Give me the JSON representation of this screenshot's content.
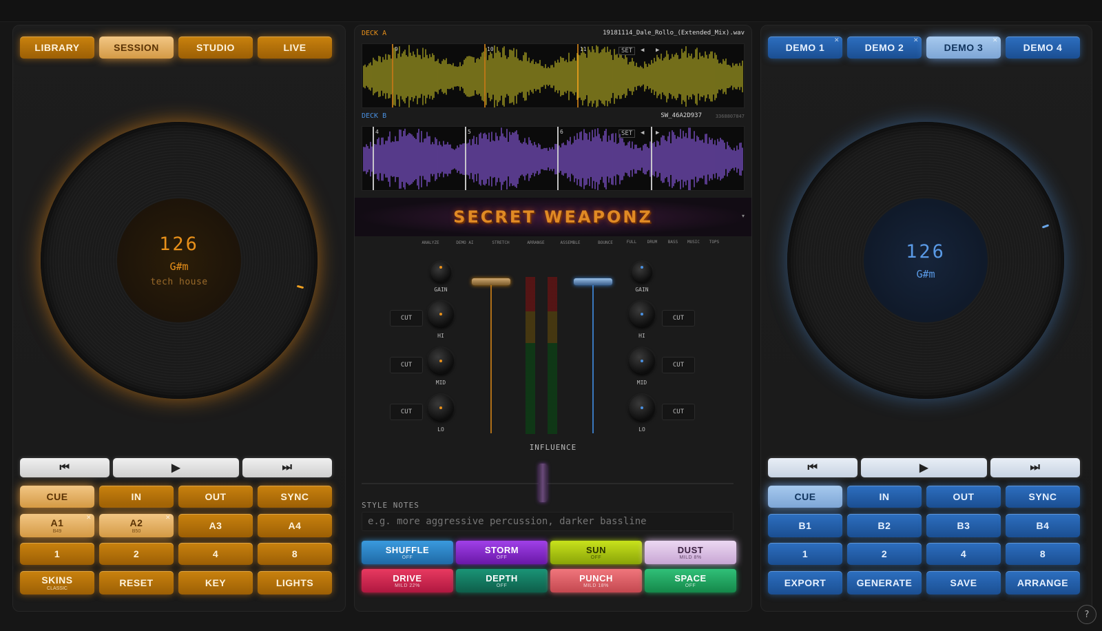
{
  "left": {
    "tabs": [
      "LIBRARY",
      "SESSION",
      "STUDIO",
      "LIVE"
    ],
    "bpm": "126",
    "key": "G#m",
    "genre": "tech house",
    "transport": {
      "prev": "⏮",
      "play": "▶",
      "next": "⏭"
    },
    "row1": [
      "CUE",
      "IN",
      "OUT",
      "SYNC"
    ],
    "row2": [
      {
        "label": "A1",
        "sub": "B49"
      },
      {
        "label": "A2",
        "sub": "B50"
      },
      {
        "label": "A3"
      },
      {
        "label": "A4"
      }
    ],
    "row3": [
      "1",
      "2",
      "4",
      "8"
    ],
    "row4": [
      {
        "label": "SKINS",
        "sub": "CLASSIC"
      },
      {
        "label": "RESET"
      },
      {
        "label": "KEY"
      },
      {
        "label": "LIGHTS"
      }
    ]
  },
  "right": {
    "tabs": [
      "DEMO 1",
      "DEMO 2",
      "DEMO 3",
      "DEMO 4"
    ],
    "bpm": "126",
    "key": "G#m",
    "transport": {
      "prev": "⏮",
      "play": "▶",
      "next": "⏭"
    },
    "row1": [
      "CUE",
      "IN",
      "OUT",
      "SYNC"
    ],
    "row2": [
      "B1",
      "B2",
      "B3",
      "B4"
    ],
    "row3": [
      "1",
      "2",
      "4",
      "8"
    ],
    "row4": [
      "EXPORT",
      "GENERATE",
      "SAVE",
      "ARRANGE"
    ]
  },
  "center": {
    "deckA": {
      "label": "DECK A",
      "file": "19181114_Dale_Rollo_(Extended_Mix).wav",
      "markers": [
        "9",
        "10",
        "11"
      ]
    },
    "deckB": {
      "label": "DECK B",
      "file": "SW_46A2D937",
      "file_extra": "3368807847",
      "markers": [
        "4",
        "5",
        "6"
      ]
    },
    "wave_ctl": {
      "set": "SET",
      "left": "◀",
      "right": "▶"
    },
    "banner": "SECRET WEAPONZ",
    "tools": [
      "ANALYZE",
      "DEMO AI",
      "STRETCH",
      "ARRANGE",
      "ASSEMBLE",
      "BOUNCE"
    ],
    "stems": [
      "FULL",
      "DRUM",
      "BASS",
      "MUSIC",
      "TOPS"
    ],
    "knobs": {
      "gain": "GAIN",
      "hi": "HI",
      "mid": "MID",
      "lo": "LO",
      "cut": "CUT"
    },
    "influence": "INFLUENCE",
    "style_notes": {
      "label": "STYLE NOTES",
      "placeholder": "e.g. more aggressive percussion, darker bassline"
    },
    "fx_row1": [
      {
        "label": "SHUFFLE",
        "sub": "OFF",
        "color": "#2f86c4"
      },
      {
        "label": "STORM",
        "sub": "OFF",
        "color": "#8a2bd0"
      },
      {
        "label": "SUN",
        "sub": "OFF",
        "color": "#a9c70e"
      },
      {
        "label": "DUST",
        "sub": "MILD 8%",
        "color": "#d9bde0"
      }
    ],
    "fx_row2": [
      {
        "label": "DRIVE",
        "sub": "MILD 22%",
        "color": "#d9294f"
      },
      {
        "label": "DEPTH",
        "sub": "OFF",
        "color": "#137a60"
      },
      {
        "label": "PUNCH",
        "sub": "MILD 18%",
        "color": "#e0626a"
      },
      {
        "label": "SPACE",
        "sub": "OFF",
        "color": "#1fa860"
      }
    ]
  },
  "help": "?",
  "colors": {
    "orange": "#e8901a",
    "blue": "#4a90e0"
  }
}
